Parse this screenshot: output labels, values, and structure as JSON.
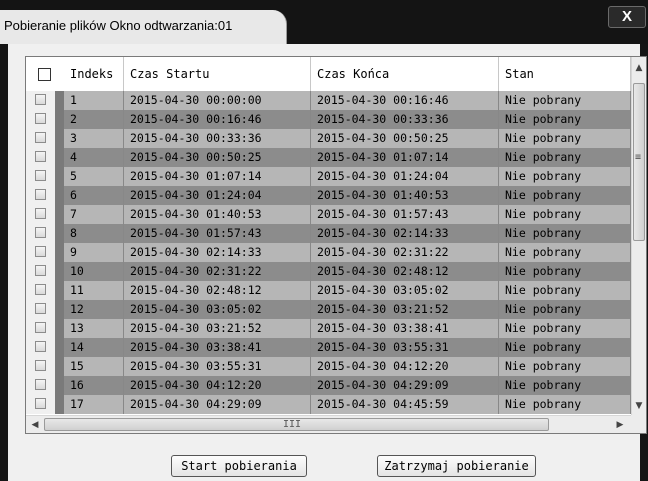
{
  "window": {
    "title": "Pobieranie plików Okno odtwarzania:01",
    "close_label": "X"
  },
  "table": {
    "columns": [
      "Indeks",
      "Czas Startu",
      "Czas Końca",
      "Stan"
    ],
    "rows": [
      {
        "index": "1",
        "start": "2015-04-30 00:00:00",
        "end": "2015-04-30 00:16:46",
        "status": "Nie pobrany"
      },
      {
        "index": "2",
        "start": "2015-04-30 00:16:46",
        "end": "2015-04-30 00:33:36",
        "status": "Nie pobrany"
      },
      {
        "index": "3",
        "start": "2015-04-30 00:33:36",
        "end": "2015-04-30 00:50:25",
        "status": "Nie pobrany"
      },
      {
        "index": "4",
        "start": "2015-04-30 00:50:25",
        "end": "2015-04-30 01:07:14",
        "status": "Nie pobrany"
      },
      {
        "index": "5",
        "start": "2015-04-30 01:07:14",
        "end": "2015-04-30 01:24:04",
        "status": "Nie pobrany"
      },
      {
        "index": "6",
        "start": "2015-04-30 01:24:04",
        "end": "2015-04-30 01:40:53",
        "status": "Nie pobrany"
      },
      {
        "index": "7",
        "start": "2015-04-30 01:40:53",
        "end": "2015-04-30 01:57:43",
        "status": "Nie pobrany"
      },
      {
        "index": "8",
        "start": "2015-04-30 01:57:43",
        "end": "2015-04-30 02:14:33",
        "status": "Nie pobrany"
      },
      {
        "index": "9",
        "start": "2015-04-30 02:14:33",
        "end": "2015-04-30 02:31:22",
        "status": "Nie pobrany"
      },
      {
        "index": "10",
        "start": "2015-04-30 02:31:22",
        "end": "2015-04-30 02:48:12",
        "status": "Nie pobrany"
      },
      {
        "index": "11",
        "start": "2015-04-30 02:48:12",
        "end": "2015-04-30 03:05:02",
        "status": "Nie pobrany"
      },
      {
        "index": "12",
        "start": "2015-04-30 03:05:02",
        "end": "2015-04-30 03:21:52",
        "status": "Nie pobrany"
      },
      {
        "index": "13",
        "start": "2015-04-30 03:21:52",
        "end": "2015-04-30 03:38:41",
        "status": "Nie pobrany"
      },
      {
        "index": "14",
        "start": "2015-04-30 03:38:41",
        "end": "2015-04-30 03:55:31",
        "status": "Nie pobrany"
      },
      {
        "index": "15",
        "start": "2015-04-30 03:55:31",
        "end": "2015-04-30 04:12:20",
        "status": "Nie pobrany"
      },
      {
        "index": "16",
        "start": "2015-04-30 04:12:20",
        "end": "2015-04-30 04:29:09",
        "status": "Nie pobrany"
      },
      {
        "index": "17",
        "start": "2015-04-30 04:29:09",
        "end": "2015-04-30 04:45:59",
        "status": "Nie pobrany"
      }
    ]
  },
  "buttons": {
    "start": "Start pobierania",
    "stop": "Zatrzymaj pobieranie"
  },
  "icons": {
    "up": "▲",
    "down": "▼",
    "left": "◀",
    "right": "▶",
    "vgrip": "≡",
    "hgrip": "III"
  },
  "colors": {
    "row_light": "#b6b6b6",
    "row_dark": "#8c8c8c"
  }
}
